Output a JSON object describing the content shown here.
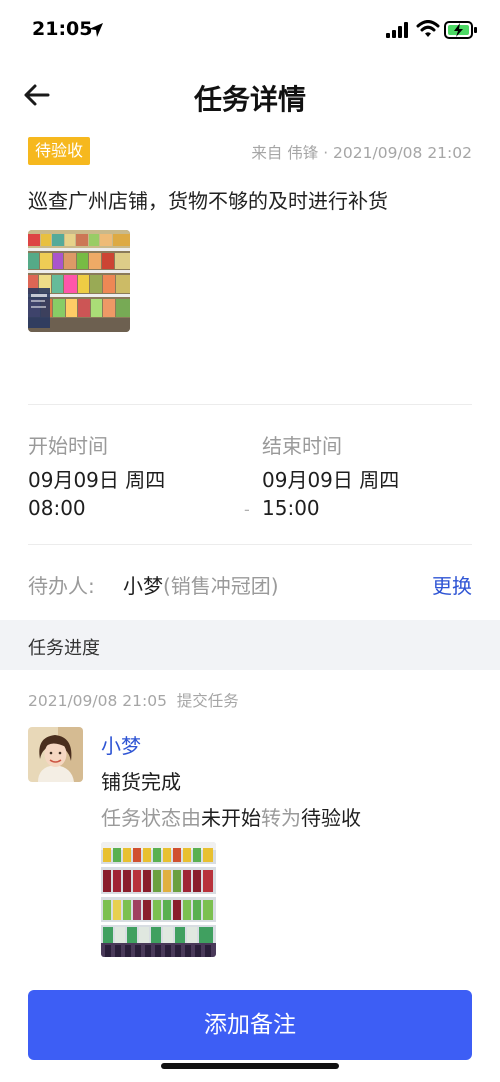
{
  "status_bar": {
    "time": "21:05"
  },
  "nav": {
    "title": "任务详情"
  },
  "task": {
    "status_badge": "待验收",
    "meta": "来自 伟锋 · 2021/09/08 21:02",
    "description": "巡查广州店铺，货物不够的及时进行补货"
  },
  "schedule": {
    "start_label": "开始时间",
    "start_date": "09月09日 周四",
    "start_time": "08:00",
    "end_label": "结束时间",
    "end_date": "09月09日 周四",
    "end_time": "15:00",
    "separator": "-"
  },
  "assignee": {
    "label": "待办人:",
    "name": "小梦",
    "team": "(销售冲冠团)",
    "change_label": "更换"
  },
  "progress": {
    "title": "任务进度",
    "entries": [
      {
        "header": "2021/09/08 21:05  提交任务",
        "user": "小梦",
        "text": "铺货完成",
        "status_prefix": "任务状态由",
        "status_from": "未开始",
        "status_mid": "转为",
        "status_to": "待验收"
      }
    ]
  },
  "footer": {
    "add_note_label": "添加备注"
  },
  "colors": {
    "accent": "#3d5ef5",
    "link": "#2f55d4",
    "badge": "#f6b81e"
  }
}
